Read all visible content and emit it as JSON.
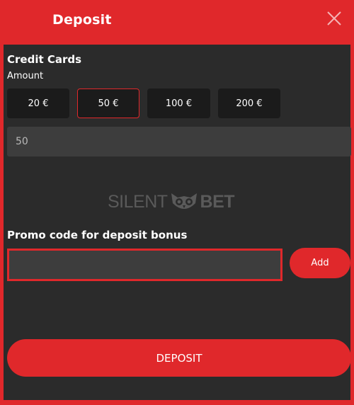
{
  "header": {
    "title": "Deposit",
    "close_icon": "close-icon"
  },
  "section": {
    "method_title": "Credit Cards",
    "amount_label": "Amount"
  },
  "amounts": {
    "options": [
      "20 €",
      "50 €",
      "100 €",
      "200 €"
    ],
    "selected": "50 €"
  },
  "amount_field": {
    "value": "50"
  },
  "watermark": {
    "left": "SILENT",
    "right": "BET",
    "icon": "owl-icon"
  },
  "promo": {
    "label": "Promo code for deposit bonus",
    "value": "",
    "add_label": "Add"
  },
  "submit": {
    "label": "DEPOSIT"
  },
  "colors": {
    "accent": "#e0282b",
    "panel": "#2b2b2b",
    "chip": "#1b1b1b",
    "field": "#3d3d3d"
  }
}
